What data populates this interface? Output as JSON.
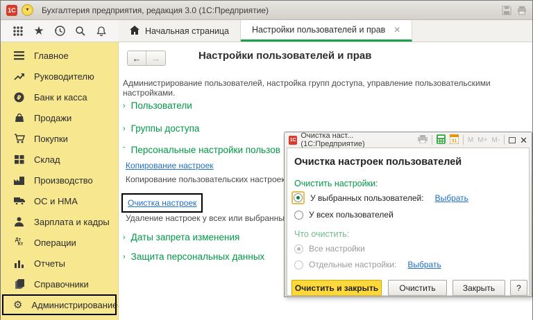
{
  "colors": {
    "green": "#009846",
    "green_muted": "#6FBE8C",
    "sidebar_yellow": "#F7E78F",
    "link_blue": "#1F6FC4",
    "button_yellow": "#FFD93B"
  },
  "window": {
    "title": "Бухгалтерия предприятия, редакция 3.0  (1С:Предприятие)",
    "logo": "1С"
  },
  "icons": {
    "chevron_collapsed": "›",
    "chevron_expanded": "ˇ",
    "menu_arrow": "▼",
    "star": "★",
    "gear": "⚙",
    "close_x": "✕",
    "calendar_day": "31"
  },
  "tabs": {
    "home": {
      "label": "Начальная страница"
    },
    "active": {
      "label": "Настройки пользователей и прав",
      "close": "✕"
    }
  },
  "sidebar": {
    "items": [
      {
        "label": "Главное",
        "icon": "menu-lines"
      },
      {
        "label": "Руководителю",
        "icon": "trend-arrow"
      },
      {
        "label": "Банк и касса",
        "icon": "ruble-circle"
      },
      {
        "label": "Продажи",
        "icon": "bag"
      },
      {
        "label": "Покупки",
        "icon": "cart"
      },
      {
        "label": "Склад",
        "icon": "grid-boxes"
      },
      {
        "label": "Производство",
        "icon": "factory"
      },
      {
        "label": "ОС и НМА",
        "icon": "truck"
      },
      {
        "label": "Зарплата и кадры",
        "icon": "person"
      },
      {
        "label": "Операции",
        "icon": "dt-kt",
        "icon_text": "Дт Кт"
      },
      {
        "label": "Отчеты",
        "icon": "bar-chart"
      },
      {
        "label": "Справочники",
        "icon": "books"
      },
      {
        "label": "Администрирование",
        "icon": "gear",
        "highlighted": true
      }
    ]
  },
  "main": {
    "title": "Настройки пользователей и прав",
    "description": "Администрирование пользователей, настройка групп доступа, управление пользовательскими настройками.",
    "sections": {
      "users": "Пользователи",
      "access_groups": "Группы доступа",
      "personal_settings": "Персональные настройки пользов",
      "change_ban_dates": "Даты запрета изменения",
      "personal_data_protection": "Защита персональных данных"
    },
    "links": {
      "copy_settings": "Копирование настроек",
      "copy_settings_desc": "Копирование пользовательских настроек м",
      "clear_settings": "Очистка настроек",
      "clear_settings_desc": "Удаление настроек у всех или выбранных п"
    }
  },
  "dialog": {
    "titlebar": {
      "title": "Очистка наст...  (1С:Предприятие)",
      "memory": [
        "M",
        "M+",
        "M-"
      ]
    },
    "heading": "Очистка настроек пользователей",
    "group1": {
      "label": "Очистить настройки:",
      "option1": {
        "label": "У выбранных пользователей:",
        "link": "Выбрать"
      },
      "option2": {
        "label": "У всех пользователей"
      }
    },
    "group2": {
      "label": "Что очистить:",
      "option1": {
        "label": "Все настройки"
      },
      "option2": {
        "label": "Отдельные настройки:",
        "link": "Выбрать"
      }
    },
    "buttons": {
      "primary": "Очистить и закрыть",
      "clear": "Очистить",
      "close": "Закрыть",
      "help": "?"
    }
  }
}
